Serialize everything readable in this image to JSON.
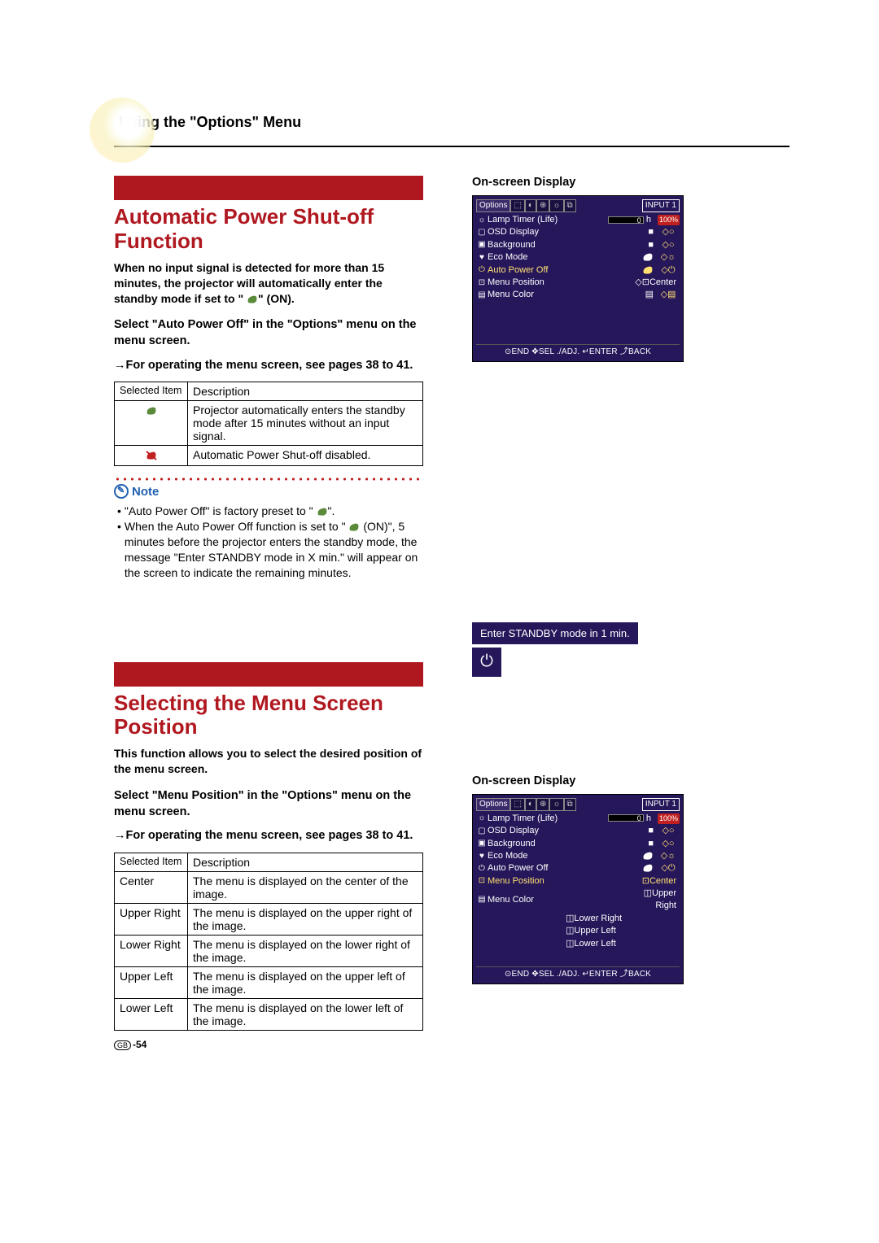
{
  "page_title": "Using the \"Options\" Menu",
  "section1": {
    "heading": "Automatic Power Shut-off Function",
    "intro": "When no input signal is detected for more than 15 minutes, the projector will automatically enter the standby mode if set to \" ",
    "intro_suffix": "\" (ON).",
    "instruct1": "Select \"Auto Power Off\" in the \"Options\" menu on the menu screen.",
    "instruct2": "→For operating the menu screen, see pages 38 to 41.",
    "table": {
      "h1": "Selected Item",
      "h2": "Description",
      "r1": "Projector automatically enters the standby mode after 15 minutes without an input signal.",
      "r2": "Automatic Power Shut-off disabled."
    },
    "note_label": "Note",
    "note1": "\"Auto Power Off\" is factory preset to \" ",
    "note1_suffix": "\".",
    "note2a": "When the Auto Power Off function is set to \" ",
    "note2b": " (ON)\", 5 minutes before the projector enters the standby mode, the message \"Enter STANDBY mode in X min.\" will appear on the screen to indicate the remaining minutes."
  },
  "osd1": {
    "label": "On-screen Display",
    "title": "Options",
    "input": "INPUT 1",
    "rows": {
      "lamp": "Lamp Timer (Life)",
      "lamp_h": "h",
      "lamp_pct": "100%",
      "osd": "OSD Display",
      "bg": "Background",
      "eco": "Eco Mode",
      "apo": "Auto Power Off",
      "mpos": "Menu Position",
      "mpos_val": "Center",
      "mcolor": "Menu Color"
    },
    "footer": "⊙END ✥SEL ./ADJ. ↵ENTER ⤴BACK"
  },
  "standby": {
    "msg": "Enter STANDBY mode in 1 min.",
    "icon": "⏻"
  },
  "section2": {
    "heading": "Selecting the Menu Screen Position",
    "intro": "This function allows you to select the desired position of the menu screen.",
    "instruct1": "Select \"Menu Position\" in the \"Options\" menu on the menu screen.",
    "instruct2": "→For operating the menu screen, see pages 38 to 41.",
    "table": {
      "h1": "Selected Item",
      "h2": "Description",
      "rows": [
        {
          "item": "Center",
          "desc": "The menu is displayed on the center of the image."
        },
        {
          "item": "Upper Right",
          "desc": "The menu is displayed on the upper right of the image."
        },
        {
          "item": "Lower Right",
          "desc": "The menu is displayed on the lower right of the image."
        },
        {
          "item": "Upper Left",
          "desc": "The menu is displayed on the upper left of the image."
        },
        {
          "item": "Lower Left",
          "desc": "The menu is displayed on the lower left of the image."
        }
      ]
    }
  },
  "osd2": {
    "label": "On-screen Display",
    "title": "Options",
    "input": "INPUT 1",
    "rows": {
      "lamp": "Lamp Timer (Life)",
      "lamp_h": "h",
      "lamp_pct": "100%",
      "osd": "OSD Display",
      "bg": "Background",
      "eco": "Eco Mode",
      "apo": "Auto Power Off",
      "mpos": "Menu Position",
      "mcolor": "Menu Color",
      "sub": [
        "Center",
        "Upper Right",
        "Lower Right",
        "Upper Left",
        "Lower Left"
      ]
    },
    "footer": "⊙END ✥SEL ./ADJ. ↵ENTER ⤴BACK"
  },
  "page_num": "-54",
  "gb": "GB"
}
